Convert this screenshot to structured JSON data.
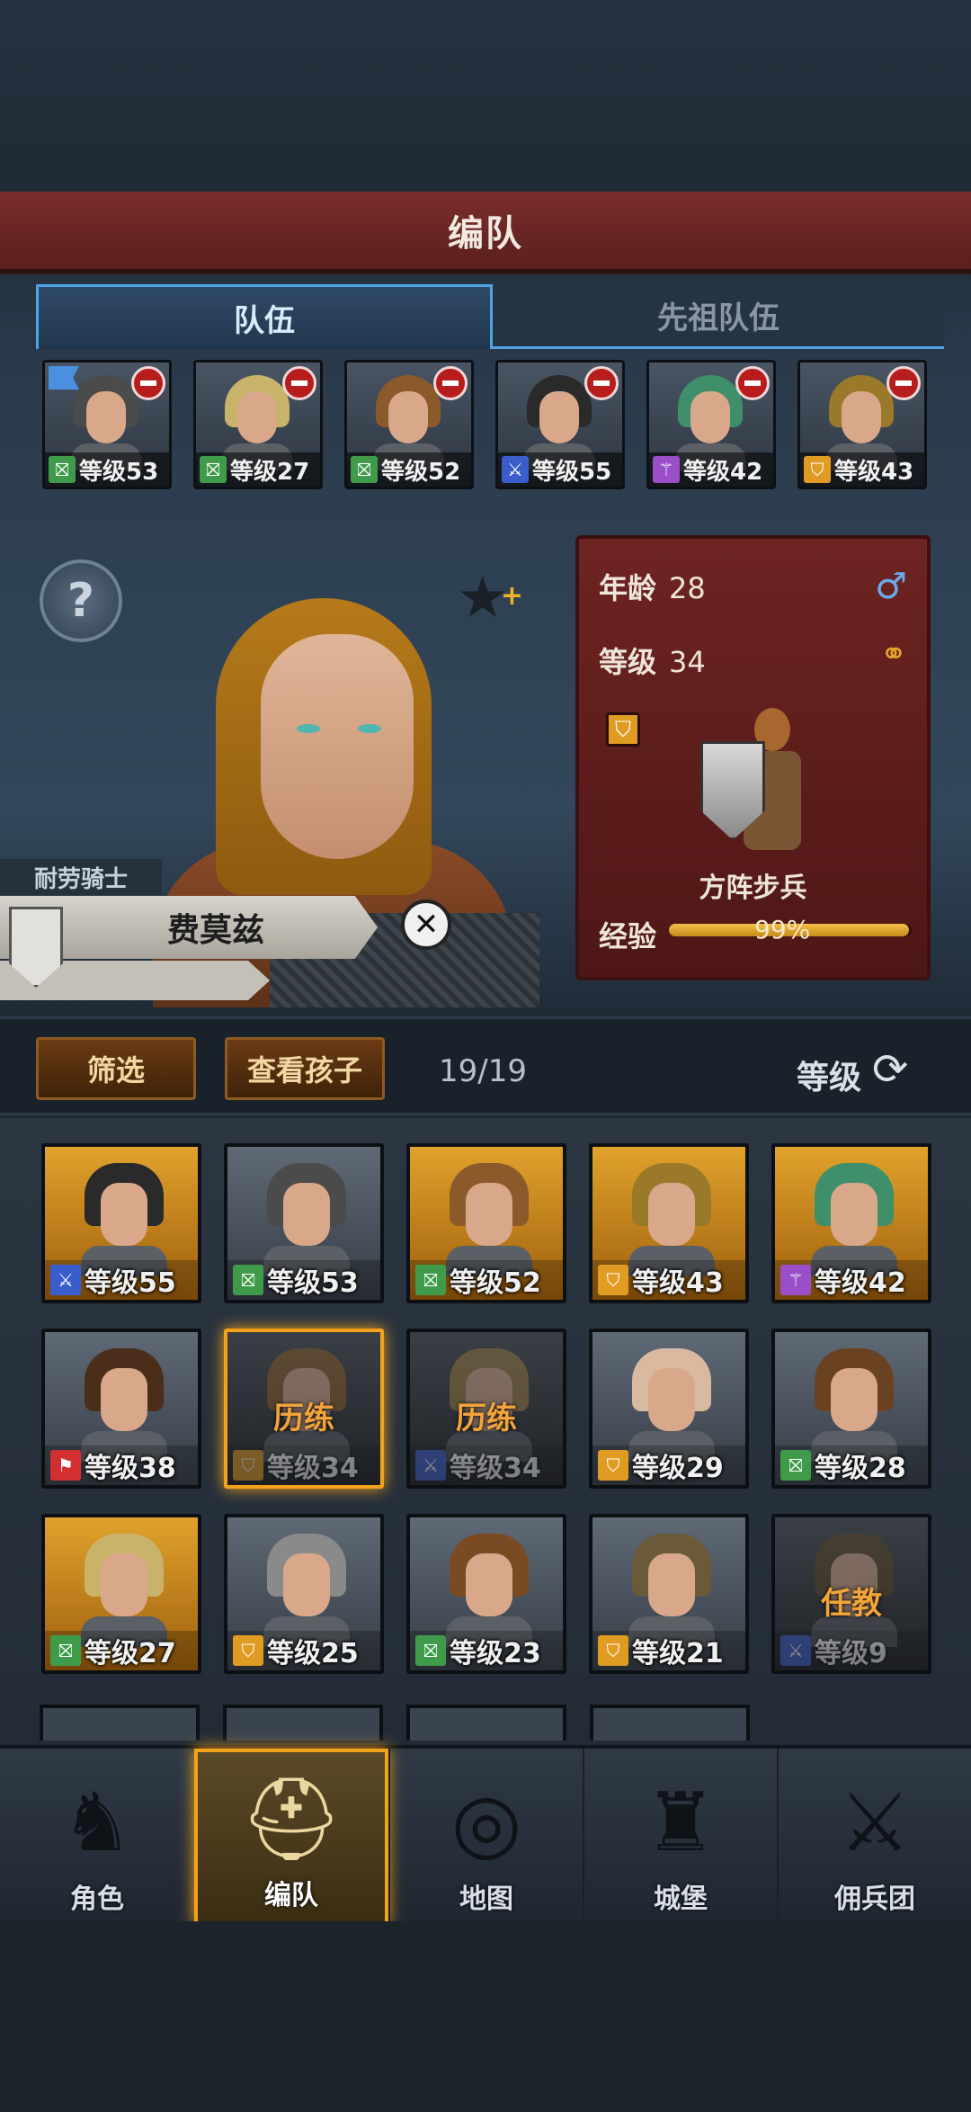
{
  "header": {
    "title": "编队"
  },
  "tabs": [
    {
      "label": "队伍",
      "active": true
    },
    {
      "label": "先祖队伍",
      "active": false
    }
  ],
  "team": [
    {
      "level": "等级53",
      "badge": "green",
      "hair": "#4b4b4b"
    },
    {
      "level": "等级27",
      "badge": "green",
      "hair": "#c9b36a"
    },
    {
      "level": "等级52",
      "badge": "green",
      "hair": "#8b5a2b"
    },
    {
      "level": "等级55",
      "badge": "blue",
      "hair": "#2a2a2a"
    },
    {
      "level": "等级42",
      "badge": "purple",
      "hair": "#3f8f6b"
    },
    {
      "level": "等级43",
      "badge": "orange",
      "hair": "#9a7a2a"
    }
  ],
  "hero": {
    "trait": "耐劳骑士",
    "name": "费莫兹",
    "age_label": "年龄",
    "age": "28",
    "level_label": "等级",
    "level": "34",
    "class_name": "方阵步兵",
    "exp_label": "经验",
    "exp_percent": "99%",
    "exp_fraction": 0.99,
    "gender_icon": "♂",
    "married_icon": "rings-icon"
  },
  "filter": {
    "filter_button": "筛选",
    "children_button": "查看孩子",
    "count": "19/19",
    "sort_label": "等级"
  },
  "roster": [
    {
      "level": "等级55",
      "badge": "blue",
      "bg": "orange",
      "hair": "#2a2a2a"
    },
    {
      "level": "等级53",
      "badge": "green",
      "bg": "gray",
      "hair": "#4b4b4b"
    },
    {
      "level": "等级52",
      "badge": "green",
      "bg": "orange",
      "hair": "#8b5a2b"
    },
    {
      "level": "等级43",
      "badge": "orange",
      "bg": "orange",
      "hair": "#9a7a2a"
    },
    {
      "level": "等级42",
      "badge": "purple",
      "bg": "orange",
      "hair": "#3f8f6b"
    },
    {
      "level": "等级38",
      "badge": "red",
      "bg": "gray",
      "hair": "#4a2e1a"
    },
    {
      "level": "等级34",
      "badge": "orange",
      "bg": "dark",
      "hair": "#8a5a22",
      "status": "历练",
      "selected": true
    },
    {
      "level": "等级34",
      "badge": "blue",
      "bg": "dark",
      "hair": "#9a7a3a",
      "status": "历练"
    },
    {
      "level": "等级29",
      "badge": "orange",
      "bg": "gray",
      "hair": "#d9b9a0"
    },
    {
      "level": "等级28",
      "badge": "green",
      "bg": "gray",
      "hair": "#6a4222"
    },
    {
      "level": "等级27",
      "badge": "green",
      "bg": "orange",
      "hair": "#c9b36a"
    },
    {
      "level": "等级25",
      "badge": "orange",
      "bg": "gray",
      "hair": "#8a8a8a"
    },
    {
      "level": "等级23",
      "badge": "green",
      "bg": "gray",
      "hair": "#7a4a22"
    },
    {
      "level": "等级21",
      "badge": "orange",
      "bg": "gray",
      "hair": "#6a5a3a"
    },
    {
      "level": "等级9",
      "badge": "blue",
      "bg": "dark",
      "hair": "#5a4222",
      "status": "任教"
    }
  ],
  "nav": [
    {
      "label": "角色",
      "icon": "knight-icon"
    },
    {
      "label": "编队",
      "icon": "helmet-icon",
      "active": true
    },
    {
      "label": "地图",
      "icon": "compass-map-icon"
    },
    {
      "label": "城堡",
      "icon": "castle-icon"
    },
    {
      "label": "佣兵团",
      "icon": "mercenary-icon"
    }
  ]
}
